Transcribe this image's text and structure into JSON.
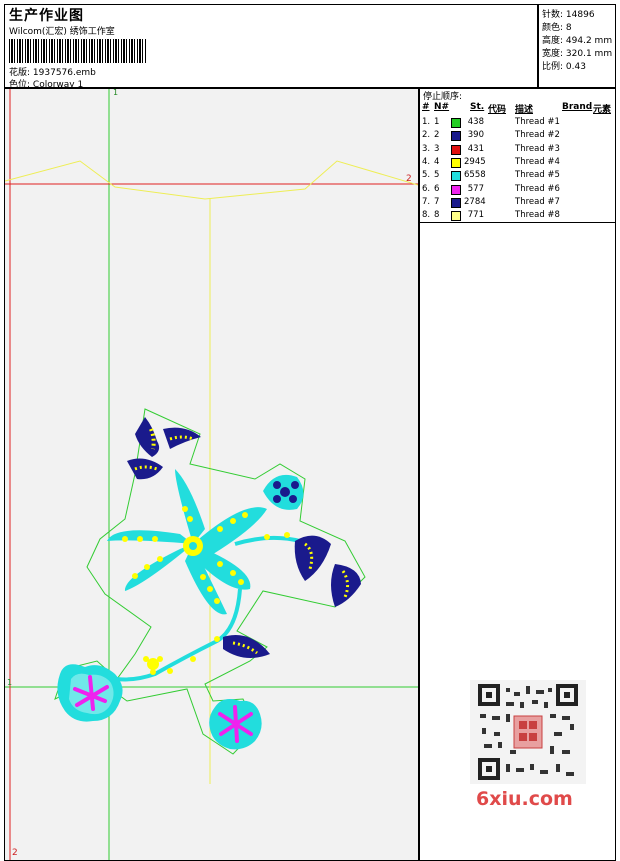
{
  "header": {
    "title": "生产作业图",
    "company": "Wilcom(汇宏) 绣饰工作室",
    "design_label": "花版:",
    "design_value": "1937576.emb",
    "colorway_label": "色位:",
    "colorway_value": "Colorway 1"
  },
  "stats": [
    {
      "label": "针数:",
      "value": "14896"
    },
    {
      "label": "颜色:",
      "value": "8"
    },
    {
      "label": "高度:",
      "value": "494.2 mm"
    },
    {
      "label": "宽度:",
      "value": "320.1 mm"
    },
    {
      "label": "比例:",
      "value": "0.43"
    }
  ],
  "legend": {
    "title": "停止顺序:",
    "headers": [
      "#",
      "N#",
      "St.",
      "代码",
      "描述",
      "Brand",
      "元素"
    ],
    "rows": [
      {
        "num": "1.",
        "n": "1",
        "color": "#22cc22",
        "st": "438",
        "desc": "Thread #1"
      },
      {
        "num": "2.",
        "n": "2",
        "color": "#1a1a8c",
        "st": "390",
        "desc": "Thread #2"
      },
      {
        "num": "3.",
        "n": "3",
        "color": "#e01010",
        "st": "431",
        "desc": "Thread #3"
      },
      {
        "num": "4.",
        "n": "4",
        "color": "#ffff00",
        "st": "2945",
        "desc": "Thread #4"
      },
      {
        "num": "5.",
        "n": "5",
        "color": "#22dddd",
        "st": "6558",
        "desc": "Thread #5"
      },
      {
        "num": "6.",
        "n": "6",
        "color": "#ee22ee",
        "st": "577",
        "desc": "Thread #6"
      },
      {
        "num": "7.",
        "n": "7",
        "color": "#1a1a8c",
        "st": "2784",
        "desc": "Thread #7"
      },
      {
        "num": "8.",
        "n": "8",
        "color": "#ffff88",
        "st": "771",
        "desc": "Thread #8"
      }
    ]
  },
  "canvas": {
    "guide_top_label": "1",
    "guide_left_label": "1",
    "guide_right_label": "2",
    "guide_bottom_label": "2"
  },
  "watermark": {
    "brand": "6xiu.com"
  }
}
